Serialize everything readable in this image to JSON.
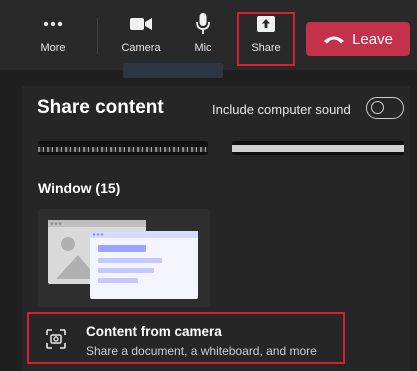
{
  "toolbar": {
    "more_label": "More",
    "camera_label": "Camera",
    "mic_label": "Mic",
    "share_label": "Share",
    "leave_label": "Leave"
  },
  "share_panel": {
    "title": "Share content",
    "include_sound_label": "Include computer sound",
    "include_sound_on": false,
    "window_section": "Window (15)",
    "camera_option": {
      "title": "Content from camera",
      "subtitle": "Share a document, a whiteboard, and more"
    }
  },
  "colors": {
    "leave": "#c4314b",
    "highlight": "#d61f2f",
    "background": "#1f1f1f",
    "accent_purple": "#9ea2ff"
  },
  "icons": [
    "more-icon",
    "camera-icon",
    "mic-icon",
    "share-icon",
    "phone-hangup-icon",
    "camera-scan-icon"
  ]
}
